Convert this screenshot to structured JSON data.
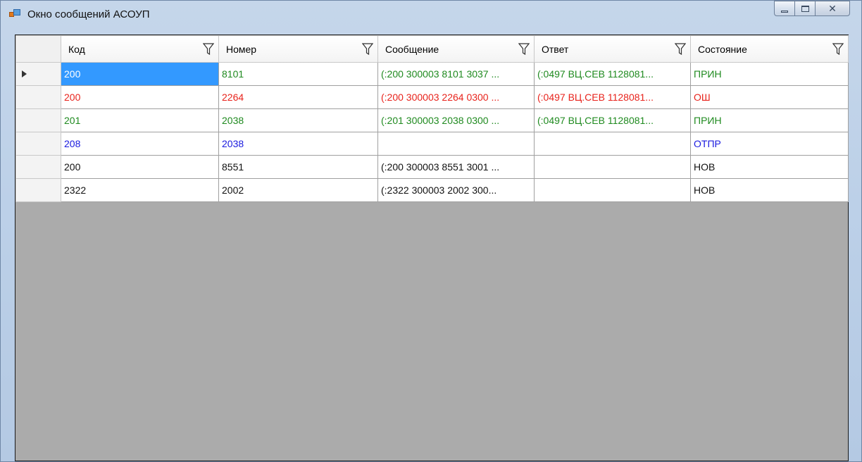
{
  "window": {
    "title": "Окно сообщений АСОУП"
  },
  "table": {
    "columns": [
      "Код",
      "Номер",
      "Сообщение",
      "Ответ",
      "Состояние"
    ],
    "rows": [
      {
        "status_color": "green",
        "kod": "200",
        "nomer": "8101",
        "soobshenie": "(:200 300003 8101 3037 ...",
        "otvet": "(:0497 ВЦ.СЕВ  1128081...",
        "sostoyanie": "ПРИН",
        "current": true
      },
      {
        "status_color": "red",
        "kod": "200",
        "nomer": "2264",
        "soobshenie": "(:200 300003 2264 0300 ...",
        "otvet": "(:0497 ВЦ.СЕВ  1128081...",
        "sostoyanie": "ОШ"
      },
      {
        "status_color": "green",
        "kod": "201",
        "nomer": "2038",
        "soobshenie": "(:201 300003 2038 0300 ...",
        "otvet": "(:0497 ВЦ.СЕВ  1128081...",
        "sostoyanie": "ПРИН"
      },
      {
        "status_color": "blue",
        "kod": "208",
        "nomer": "2038",
        "soobshenie": "",
        "otvet": "",
        "sostoyanie": "ОТПР"
      },
      {
        "status_color": "black",
        "kod": "200",
        "nomer": "8551",
        "soobshenie": "(:200 300003 8551 3001 ...",
        "otvet": "",
        "sostoyanie": "НОВ"
      },
      {
        "status_color": "black",
        "kod": "2322",
        "nomer": "2002",
        "soobshenie": "(:2322 300003 2002 300...",
        "otvet": "",
        "sostoyanie": "НОВ"
      }
    ]
  },
  "colors": {
    "green": "#1f8a1f",
    "red": "#e8231c",
    "blue": "#1a1adf",
    "black": "#111111",
    "selection": "#3399ff",
    "empty_area": "#ababab"
  },
  "icons": {
    "filter": "filter-funnel-icon",
    "row_indicator": "current-row-arrow-icon"
  }
}
